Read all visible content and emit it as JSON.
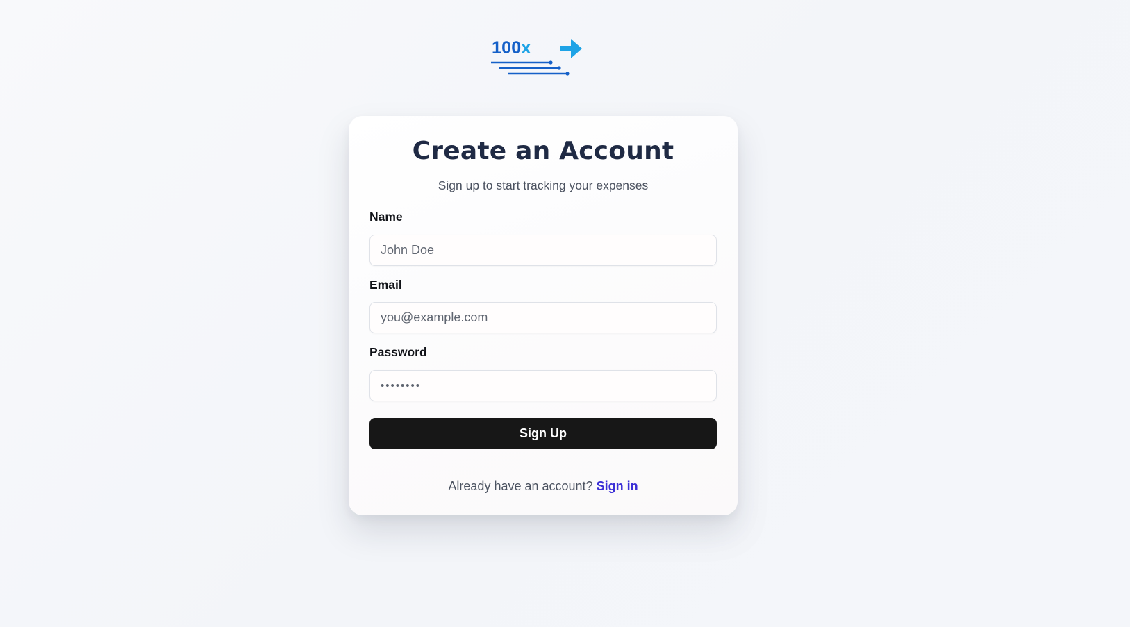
{
  "logo": {
    "number": "100",
    "suffix": "x",
    "icon": "arrow-right-icon",
    "colors": {
      "primary": "#1560c8",
      "accent": "#1ea3e6"
    }
  },
  "form": {
    "title": "Create an Account",
    "subtitle": "Sign up to start tracking your expenses",
    "name": {
      "label": "Name",
      "placeholder": "John Doe",
      "value": ""
    },
    "email": {
      "label": "Email",
      "placeholder": "you@example.com",
      "value": ""
    },
    "password": {
      "label": "Password",
      "placeholder": "••••••••",
      "value": ""
    },
    "submit_label": "Sign Up",
    "footer_text": "Already have an account?",
    "signin_label": "Sign in"
  },
  "colors": {
    "button_bg": "#171717",
    "link": "#3b2fd6",
    "title": "#1f2a44"
  }
}
